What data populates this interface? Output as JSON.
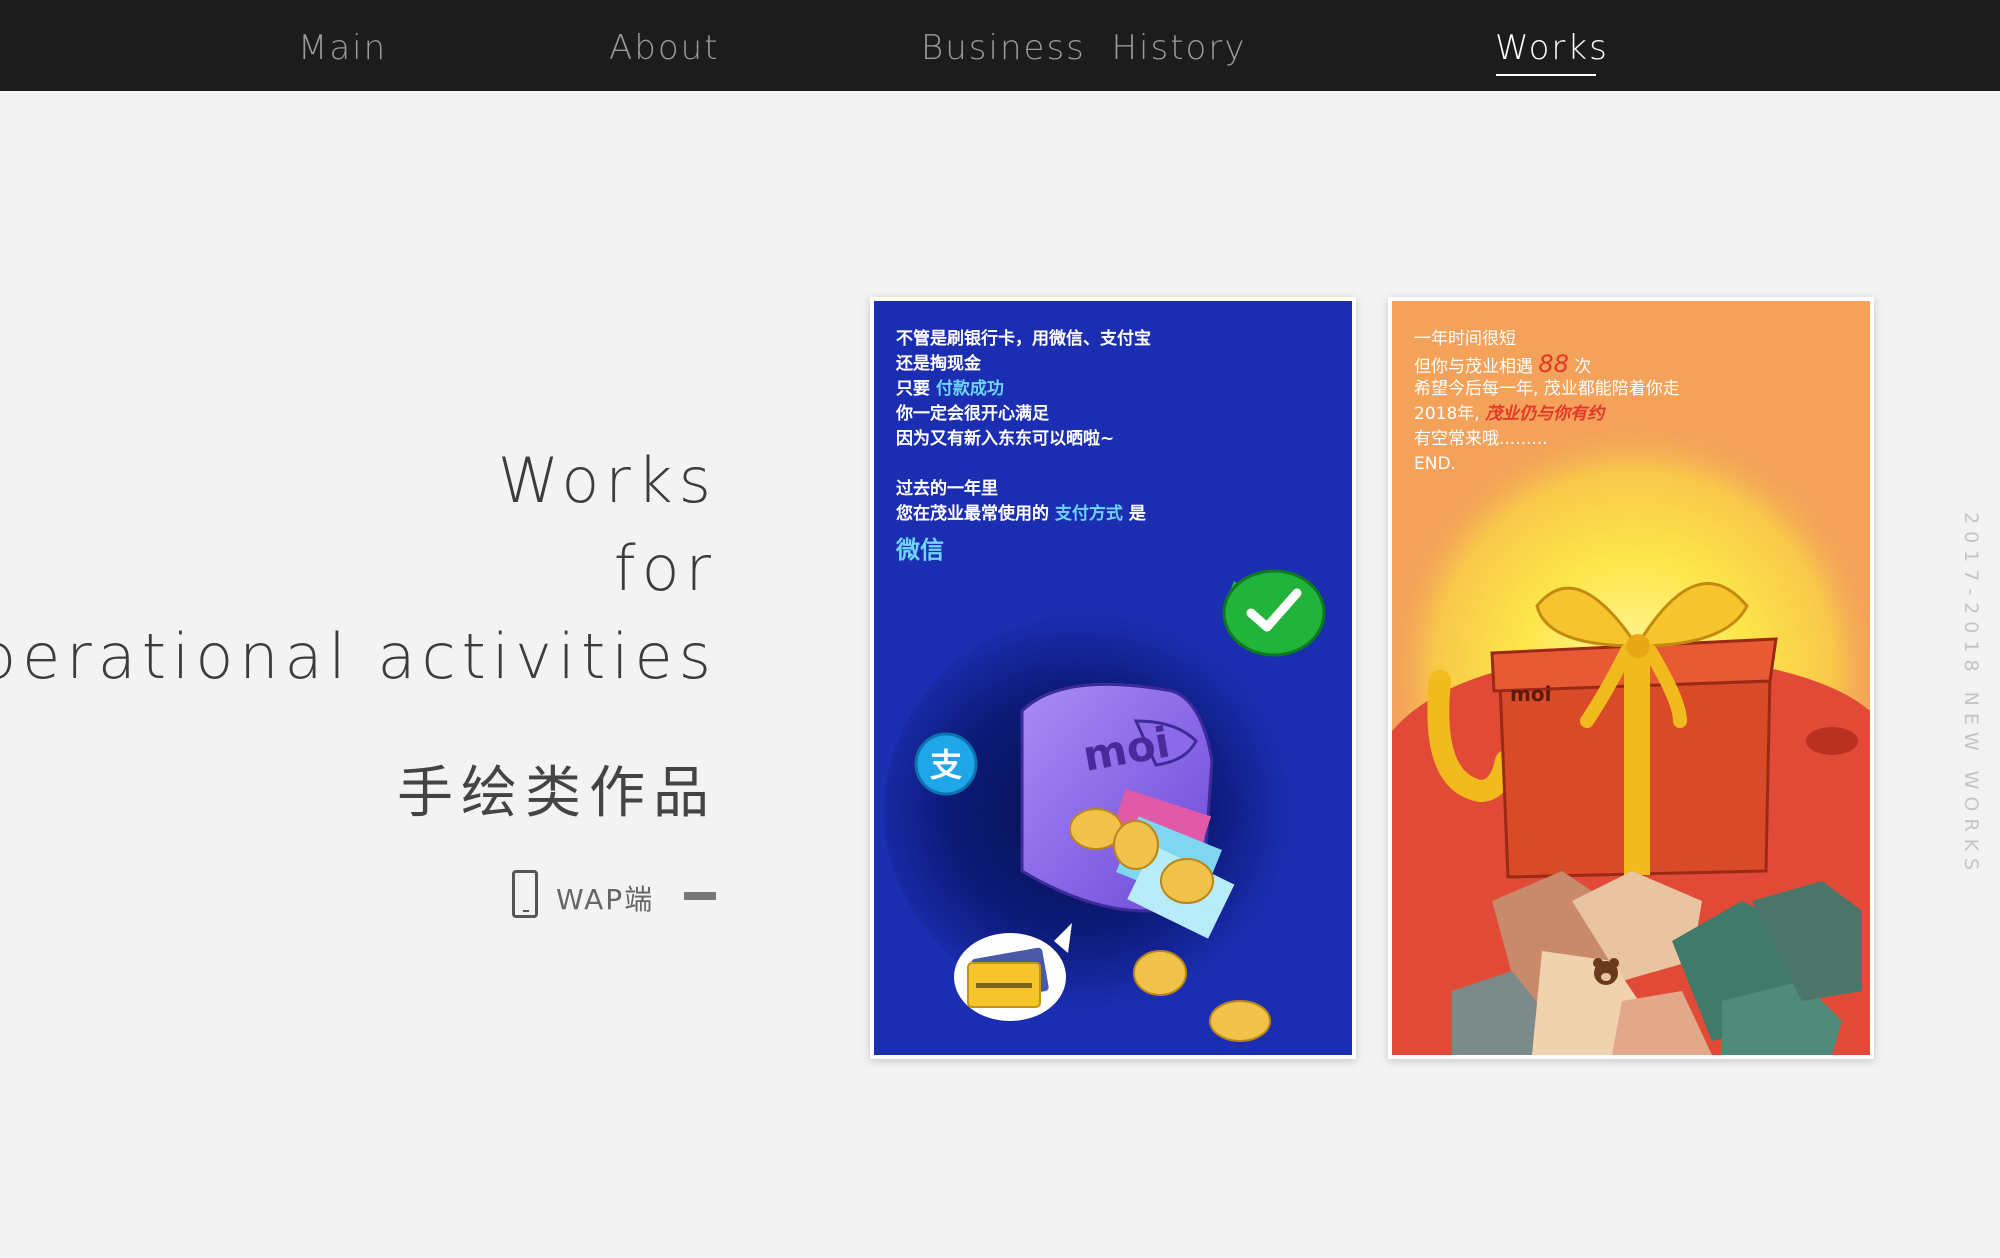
{
  "nav": {
    "items": [
      {
        "label": "Main"
      },
      {
        "label": "About"
      },
      {
        "label": "Business  History"
      },
      {
        "label": "Works"
      }
    ],
    "active_index": 3
  },
  "hero": {
    "line1": "Works",
    "line2": "for",
    "line3": "Operational activities",
    "line4": "手绘类作品",
    "platform_label": "WAP端",
    "platform_icon": "mobile-phone-icon"
  },
  "side_text": "2017-2018 NEW WORKS",
  "cards": [
    {
      "lines": {
        "l1": "不管是刷银行卡，用微信、支付宝",
        "l2": "还是掏现金",
        "l3_prefix": "只要 ",
        "l3_hl": "付款成功",
        "l4": "你一定会很开心满足",
        "l5": "因为又有新入东东可以晒啦~",
        "l6": "过去的一年里",
        "l7_prefix": "您在茂业最常使用的 ",
        "l7_hl": "支付方式",
        "l7_suffix": " 是",
        "l8": "微信"
      },
      "wallet_logo": "moi",
      "alipay_char": "支"
    },
    {
      "lines": {
        "l1": "一年时间很短",
        "l2_prefix": "但你与茂业相遇 ",
        "l2_hl": "88",
        "l2_suffix": " 次",
        "l3": "希望今后每一年, 茂业都能陪着你走",
        "l4_prefix": "2018年, ",
        "l4_hl": "茂业仍与你有约",
        "l5": "有空常来哦.........",
        "l6": "END."
      },
      "gift_logo": "moi"
    }
  ],
  "colors": {
    "nav_bg": "#1c1c1c",
    "page_bg": "#f3f3f3",
    "card1_bg": "#1b2eb2",
    "card2_bg": "#f4a25a",
    "highlight_blue": "#6fd4ff",
    "highlight_red": "#e2392b"
  }
}
